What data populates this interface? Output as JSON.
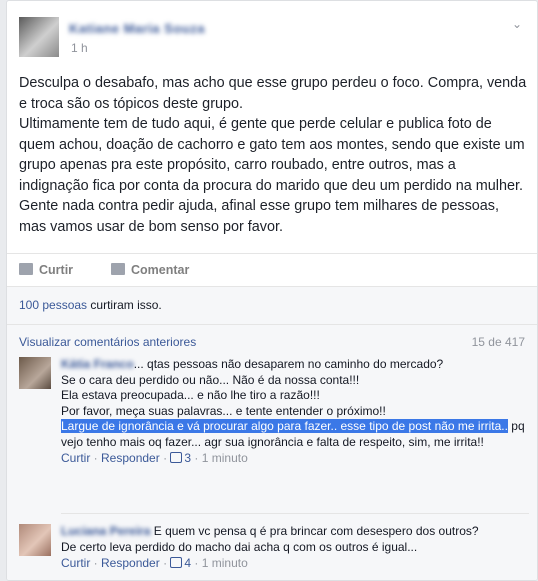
{
  "post": {
    "author": "Katiane Maria Souza",
    "time": "1 h",
    "paragraphs": [
      "Desculpa o desabafo, mas acho que esse grupo perdeu o foco. Compra, venda e troca são os tópicos deste grupo.",
      "Ultimamente tem de tudo aqui, é gente que perde celular e publica foto de quem achou, doação de cachorro e gato tem aos montes, sendo que existe um grupo apenas pra este propósito, carro roubado, entre outros, mas a indignação fica por conta da procura do marido que deu um perdido na mulher. Gente nada contra pedir ajuda, afinal esse grupo tem milhares de pessoas, mas vamos usar de bom senso por favor."
    ]
  },
  "actions": {
    "like": "Curtir",
    "comment": "Comentar"
  },
  "likes": {
    "count_link": "100 pessoas",
    "text": " curtiram isso."
  },
  "comments_header": {
    "prev_label": "Visualizar comentários anteriores",
    "count": "15 de 417"
  },
  "comments": [
    {
      "author": "Kátia Franco",
      "lines": [
        "... qtas pessoas não desaparem no caminho do mercado?",
        "Se o cara deu perdido ou não... Não é da nossa conta!!!",
        "Ela estava preocupada... e não lhe tiro a razão!!!",
        "Por favor, meça suas palavras... e tente entender o próximo!!"
      ],
      "highlight": "Largue de ignorância e vá procurar algo para fazer.. esse tipo de post não me irrita..",
      "rest": " pq vejo tenho mais oq fazer... agr sua ignorância e falta de respeito, sim, me irrita!!",
      "reply_like": "Curtir",
      "reply_respond": "Responder",
      "likes": "3",
      "time": "1 minuto"
    },
    {
      "author": "Luciana Pereira",
      "text1": " E quem vc pensa q é pra brincar com desespero dos outros?",
      "text2": "De certo leva perdido do macho dai acha q com os outros é igual...",
      "reply_like": "Curtir",
      "reply_respond": "Responder",
      "likes": "4",
      "time": "1 minuto"
    }
  ],
  "colors": {
    "link": "#3b5998",
    "highlight": "#3b78e7",
    "muted": "#90949c"
  }
}
